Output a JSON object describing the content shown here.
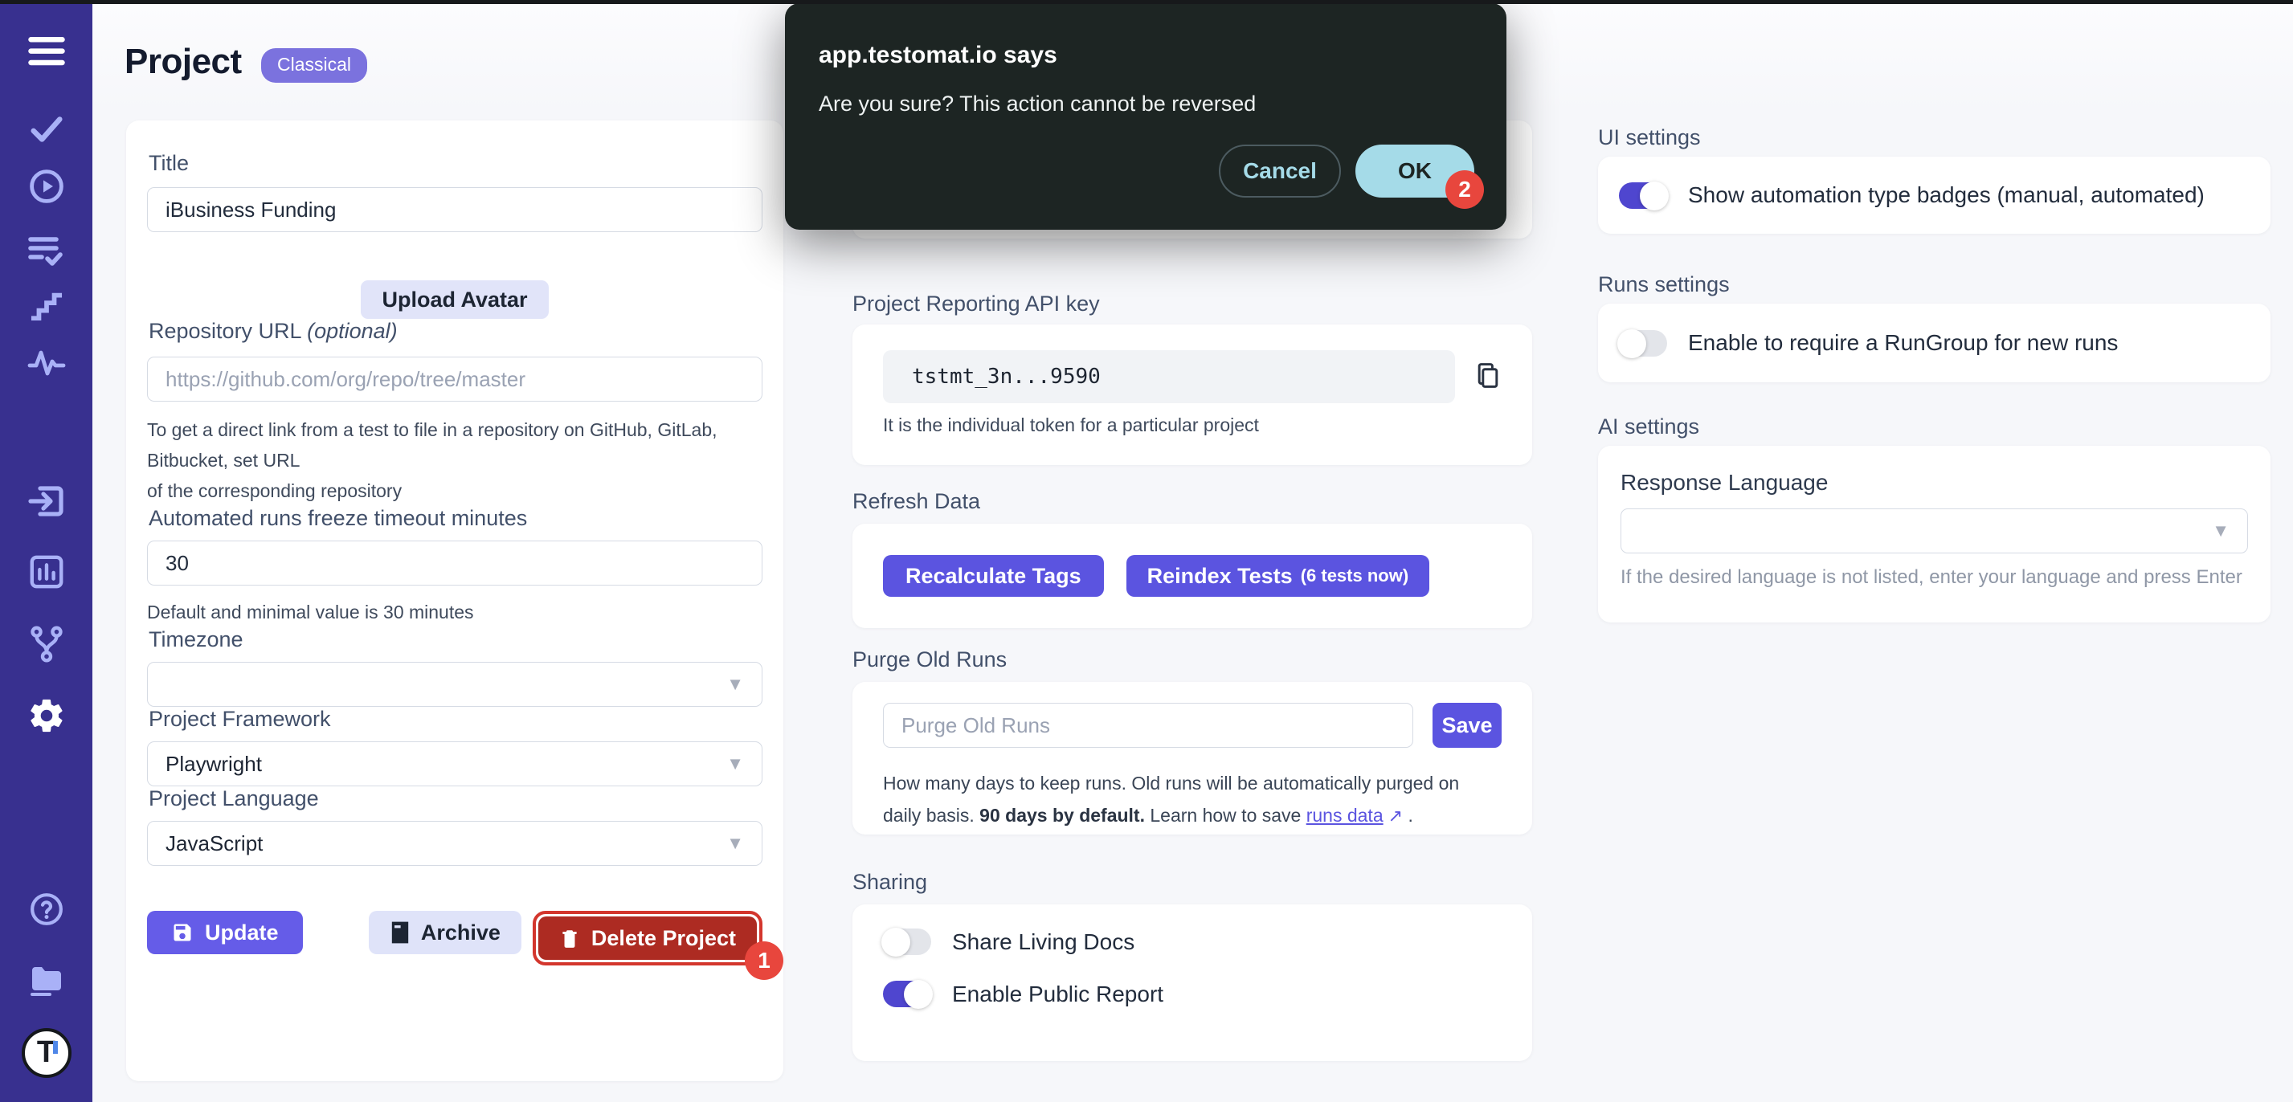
{
  "page": {
    "title": "Project",
    "badge": "Classical"
  },
  "dialog": {
    "title": "app.testomat.io says",
    "message": "Are you sure? This action cannot be reversed",
    "cancel_label": "Cancel",
    "ok_label": "OK",
    "ok_mark": "2"
  },
  "sidebar": {
    "icons": [
      "menu",
      "check",
      "play-circle",
      "list-check",
      "stairs",
      "pulse",
      "import",
      "bar-chart",
      "git-branch",
      "gear",
      "help-circle",
      "folder",
      "logo"
    ]
  },
  "left_form": {
    "title_label": "Title",
    "title_value": "iBusiness Funding",
    "upload_avatar_label": "Upload Avatar",
    "repo_label": "Repository URL ",
    "repo_optional": "(optional)",
    "repo_placeholder": "https://github.com/org/repo/tree/master",
    "repo_help_line1": "To get a direct link from a test to file in a repository on GitHub, GitLab, Bitbucket, set URL",
    "repo_help_line2": "of the corresponding repository",
    "freeze_label": "Automated runs freeze timeout minutes",
    "freeze_value": "30",
    "freeze_help": "Default and minimal value is 30 minutes",
    "timezone_label": "Timezone",
    "timezone_value": "",
    "framework_label": "Project Framework",
    "framework_value": "Playwright",
    "language_label": "Project Language",
    "language_value": "JavaScript",
    "update_label": "Update",
    "archive_label": "Archive",
    "delete_label": "Delete Project",
    "delete_mark": "1"
  },
  "middle": {
    "api_key": {
      "label": "Project Reporting API key",
      "value": "tstmt_3n...9590",
      "help": "It is the individual token for a particular project"
    },
    "refresh": {
      "label": "Refresh Data",
      "recalculate_label": "Recalculate Tags",
      "reindex_label": "Reindex Tests",
      "reindex_note": "(6 tests now)"
    },
    "purge": {
      "label": "Purge Old Runs",
      "placeholder": "Purge Old Runs",
      "save_label": "Save",
      "help_part1": "How many days to keep runs. Old runs will be automatically purged on daily basis. ",
      "help_bold": "90 days by default.",
      "help_part2": " Learn how to save ",
      "link_label": "runs data",
      "link_arrow": "↗",
      "help_part3": " ."
    },
    "sharing": {
      "label": "Sharing",
      "toggles": [
        {
          "label": "Share Living Docs",
          "on": false
        },
        {
          "label": "Enable Public Report",
          "on": true
        }
      ]
    }
  },
  "right": {
    "ui_settings": {
      "label": "UI settings",
      "toggle_label": "Show automation type badges (manual, automated)",
      "on": true
    },
    "runs_settings": {
      "label": "Runs settings",
      "toggle_label": "Enable to require a RunGroup for new runs",
      "on": false
    },
    "ai_settings": {
      "label": "AI settings",
      "response_label": "Response Language",
      "response_value": "",
      "help": "If the desired language is not listed, enter your language and press Enter"
    }
  },
  "colors": {
    "sidebar": "#38308f",
    "primary": "#5b54e0",
    "toggle_on": "#4f46cf",
    "delete_red": "#ad2b22",
    "annotation_red": "#e8463d",
    "dialog_bg": "#1d2523",
    "ok_button": "#a5dbe8",
    "badge_purple": "#7b72de"
  }
}
